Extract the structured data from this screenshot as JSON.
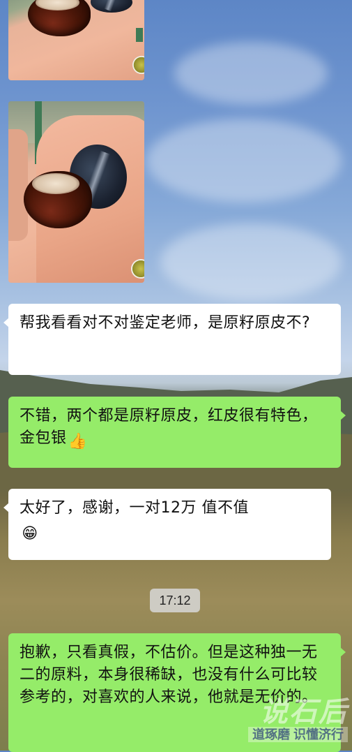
{
  "messages": [
    {
      "side": "in",
      "text": "帮我看看对不对鉴定老师，是原籽原皮不?"
    },
    {
      "side": "out",
      "text": "不错，两个都是原籽原皮，红皮很有特色，金包银",
      "emoji": "thumbs-up-icon",
      "emoji_char": "👍"
    },
    {
      "side": "in",
      "text": "太好了，感谢，一对12万 值不值",
      "emoji": "grinning-face-icon",
      "emoji_char": "😁"
    },
    {
      "side": "out",
      "text": "抱歉，只看真假，不估价。但是这种独一无二的原料，本身很稀缺，也没有什么可比较参考的，对喜欢的人来说，他就是无价的。"
    }
  ],
  "timestamp": "17:12",
  "colors": {
    "incoming_bubble": "#ffffff",
    "outgoing_bubble": "#95ec69",
    "timestamp_pill": "#d7d7d7"
  }
}
